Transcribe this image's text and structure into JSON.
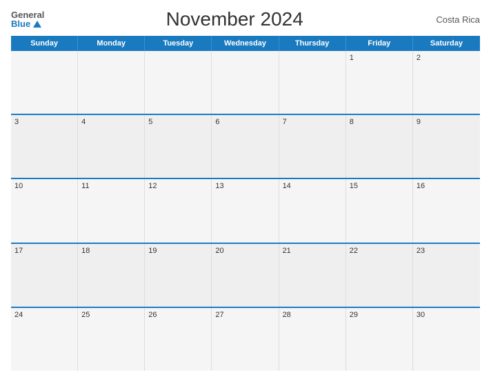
{
  "header": {
    "logo_general": "General",
    "logo_blue": "Blue",
    "title": "November 2024",
    "country": "Costa Rica"
  },
  "calendar": {
    "days_of_week": [
      "Sunday",
      "Monday",
      "Tuesday",
      "Wednesday",
      "Thursday",
      "Friday",
      "Saturday"
    ],
    "rows": [
      [
        {
          "day": "",
          "empty": true
        },
        {
          "day": "",
          "empty": true
        },
        {
          "day": "",
          "empty": true
        },
        {
          "day": "",
          "empty": true
        },
        {
          "day": "",
          "empty": true
        },
        {
          "day": "1",
          "empty": false
        },
        {
          "day": "2",
          "empty": false
        }
      ],
      [
        {
          "day": "3",
          "empty": false
        },
        {
          "day": "4",
          "empty": false
        },
        {
          "day": "5",
          "empty": false
        },
        {
          "day": "6",
          "empty": false
        },
        {
          "day": "7",
          "empty": false
        },
        {
          "day": "8",
          "empty": false
        },
        {
          "day": "9",
          "empty": false
        }
      ],
      [
        {
          "day": "10",
          "empty": false
        },
        {
          "day": "11",
          "empty": false
        },
        {
          "day": "12",
          "empty": false
        },
        {
          "day": "13",
          "empty": false
        },
        {
          "day": "14",
          "empty": false
        },
        {
          "day": "15",
          "empty": false
        },
        {
          "day": "16",
          "empty": false
        }
      ],
      [
        {
          "day": "17",
          "empty": false
        },
        {
          "day": "18",
          "empty": false
        },
        {
          "day": "19",
          "empty": false
        },
        {
          "day": "20",
          "empty": false
        },
        {
          "day": "21",
          "empty": false
        },
        {
          "day": "22",
          "empty": false
        },
        {
          "day": "23",
          "empty": false
        }
      ],
      [
        {
          "day": "24",
          "empty": false
        },
        {
          "day": "25",
          "empty": false
        },
        {
          "day": "26",
          "empty": false
        },
        {
          "day": "27",
          "empty": false
        },
        {
          "day": "28",
          "empty": false
        },
        {
          "day": "29",
          "empty": false
        },
        {
          "day": "30",
          "empty": false
        }
      ]
    ]
  }
}
